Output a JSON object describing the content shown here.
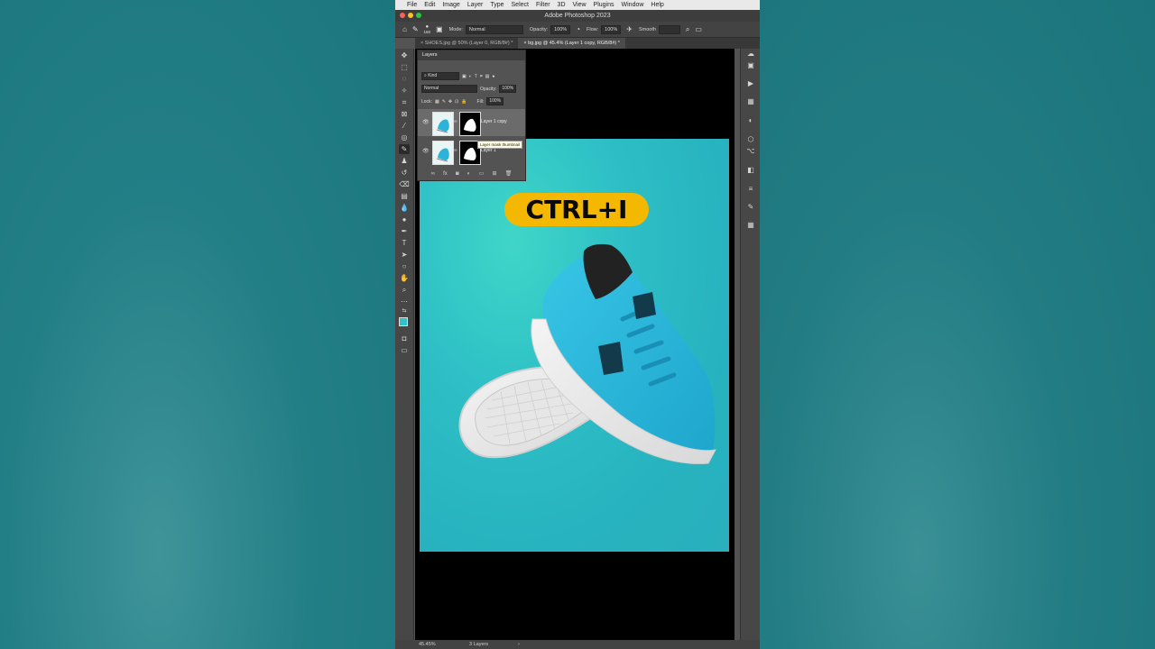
{
  "menubar": {
    "items": [
      "File",
      "Edit",
      "Image",
      "Layer",
      "Type",
      "Select",
      "Filter",
      "3D",
      "View",
      "Plugins",
      "Window",
      "Help"
    ]
  },
  "window": {
    "title": "Adobe Photoshop 2023"
  },
  "options_bar": {
    "brush_size": "160",
    "mode_label": "Mode:",
    "mode_value": "Normal",
    "opacity_label": "Opacity:",
    "opacity_value": "100%",
    "flow_label": "Flow:",
    "flow_value": "100%",
    "smoothing_label": "Smooth"
  },
  "tabs": [
    {
      "label": "SHOES.jpg @ 50% (Layer 0, RGB/8#) *"
    },
    {
      "label": "bg.jpg @ 45.4% (Layer 1 copy, RGB/8#) *"
    }
  ],
  "layers_panel": {
    "title": "Layers",
    "kind": "Kind",
    "blend_mode": "Normal",
    "opacity_label": "Opacity:",
    "opacity_value": "100%",
    "lock_label": "Lock:",
    "fill_label": "Fill:",
    "fill_value": "100%",
    "layers": [
      {
        "name": "Layer 1 copy",
        "selected": true
      },
      {
        "name": "Layer 1",
        "selected": false
      }
    ],
    "tooltip": "Layer mask thumbnail"
  },
  "canvas": {
    "overlay_text": "CTRL+I",
    "pill_color": "#f5b800",
    "background_color": "#2db8c2",
    "shoe_color": "#2bb3d8"
  },
  "status": {
    "zoom": "45.45%",
    "info": "3 Layers"
  }
}
